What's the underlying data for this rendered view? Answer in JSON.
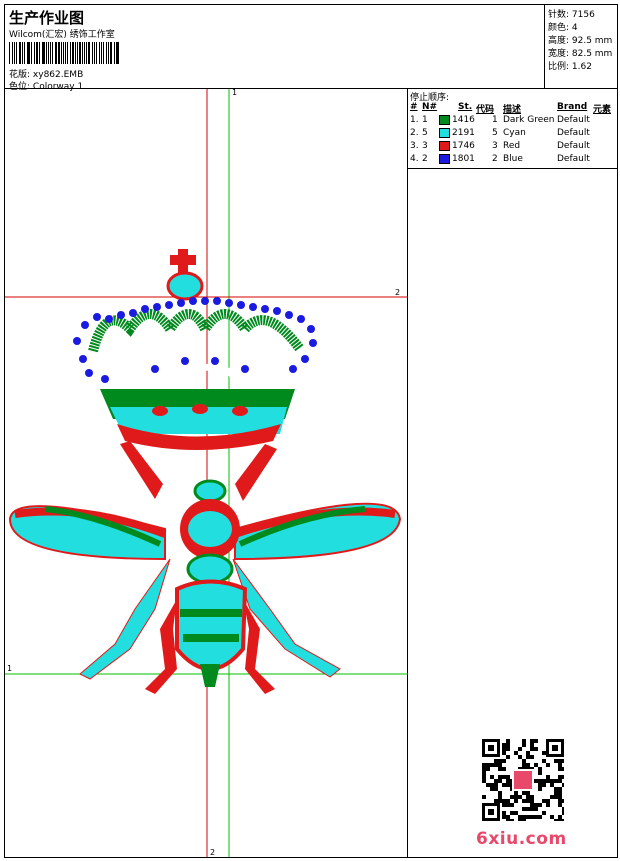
{
  "header": {
    "title": "生产作业图",
    "software": "Wilcom(汇宏) 绣饰工作室",
    "design_label": "花版:",
    "design_value": "xy862.EMB",
    "colorway_label": "色位:",
    "colorway_value": "Colorway 1"
  },
  "stats": {
    "stitches": "针数: 7156",
    "colors": "颜色: 4",
    "height": "高度: 92.5 mm",
    "width": "宽度: 82.5 mm",
    "ratio": "比例: 1.62"
  },
  "stop_sequence": {
    "title": "停止顺序:",
    "headers": {
      "idx": "#",
      "needle": "N#",
      "stitches": "St.",
      "code": "代码",
      "desc": "描述",
      "brand": "Brand",
      "elem": "元素"
    },
    "rows": [
      {
        "idx": "1.",
        "needle": "1",
        "color": "#008a1e",
        "stitches": "1416",
        "code": "1",
        "desc": "Dark Green",
        "brand": "Default"
      },
      {
        "idx": "2.",
        "needle": "5",
        "color": "#22dede",
        "stitches": "2191",
        "code": "5",
        "desc": "Cyan",
        "brand": "Default"
      },
      {
        "idx": "3.",
        "needle": "3",
        "color": "#e01a1a",
        "stitches": "1746",
        "code": "3",
        "desc": "Red",
        "brand": "Default"
      },
      {
        "idx": "4.",
        "needle": "2",
        "color": "#1a1ae0",
        "stitches": "1801",
        "code": "2",
        "desc": "Blue",
        "brand": "Default"
      }
    ]
  },
  "canvas": {
    "marker_v1": "1",
    "marker_v2": "2",
    "marker_h1": "1",
    "marker_h2": "2"
  },
  "colors": {
    "green": "#008a1e",
    "cyan": "#22dede",
    "red": "#e01a1a",
    "blue": "#1a1ae0",
    "guide_red": "#d40000",
    "guide_green": "#00c000"
  },
  "watermark": "6xiu.com",
  "qr_label": "QR-code-icon"
}
